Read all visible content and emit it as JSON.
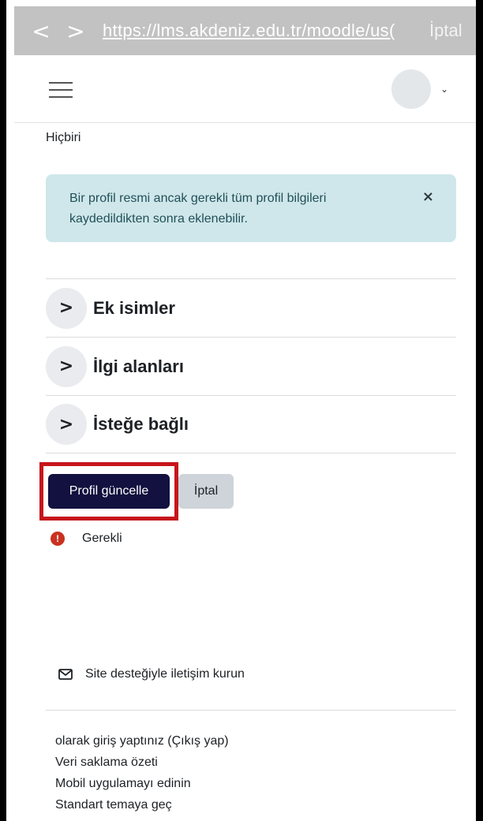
{
  "browser": {
    "back_glyph": "<",
    "forward_glyph": ">",
    "url": "https://lms.akdeniz.edu.tr/moodle/us(",
    "cancel": "İptal"
  },
  "header": {
    "menu_icon": "hamburger-icon",
    "avatar_caret": "⌄"
  },
  "form": {
    "static_value": "Hiçbiri",
    "alert": {
      "text": "Bir profil resmi ancak gerekli tüm profil bilgileri kaydedildikten sonra eklenebilir.",
      "close": "×"
    },
    "sections": [
      {
        "label": "Ek isimler",
        "toggle": ">"
      },
      {
        "label": "İlgi alanları",
        "toggle": ">"
      },
      {
        "label": "İsteğe bağlı",
        "toggle": ">"
      }
    ],
    "submit_label": "Profil güncelle",
    "cancel_label": "İptal",
    "required_icon": "!",
    "required_label": "Gerekli"
  },
  "footer": {
    "support": "Site desteğiyle iletişim kurun",
    "logged_in": "olarak giriş yaptınız (Çıkış yap)",
    "data_retention": "Veri saklama özeti",
    "mobile_app": "Mobil uygulamayı edinin",
    "standard_theme": "Standart temaya geç"
  },
  "colors": {
    "primary_button": "#12113f",
    "alert_bg": "#cfe7ea",
    "highlight": "#c6161b",
    "required_icon": "#ca3120"
  }
}
